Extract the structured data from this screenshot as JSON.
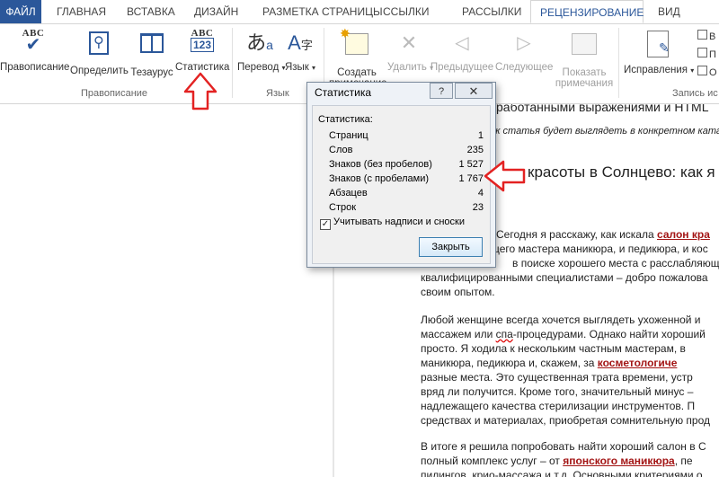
{
  "tabs": {
    "file": "ФАЙЛ",
    "items": [
      "ГЛАВНАЯ",
      "ВСТАВКА",
      "ДИЗАЙН",
      "РАЗМЕТКА СТРАНИЦЫ",
      "ССЫЛКИ",
      "РАССЫЛКИ",
      "РЕЦЕНЗИРОВАНИЕ",
      "ВИД"
    ],
    "active": "РЕЦЕНЗИРОВАНИЕ"
  },
  "ribbon": {
    "proofing": {
      "spelling": "Правописание",
      "define": "Определить",
      "thesaurus": "Тезаурус",
      "statistics": "Статистика",
      "group": "Правописание",
      "abc": "ABC",
      "num": "123"
    },
    "language": {
      "translate": "Перевод",
      "language": "Язык",
      "group": "Язык"
    },
    "comments": {
      "create1": "Создать",
      "create2": "примечание",
      "delete": "Удалить",
      "previous": "Предыдущее",
      "next": "Следующее",
      "show1": "Показать",
      "show2": "примечания",
      "group_fragment": "я"
    },
    "tracking": {
      "corrections": "Исправления",
      "group": "Запись ис",
      "small_b": "В",
      "small_p": "П",
      "small_o": "О"
    }
  },
  "dialog": {
    "title": "Статистика",
    "help": "?",
    "close_x": "✕",
    "header": "Статистика:",
    "rows": [
      {
        "label": "Страниц",
        "value": "1"
      },
      {
        "label": "Слов",
        "value": "235"
      },
      {
        "label": "Знаков (без пробелов)",
        "value": "1 527"
      },
      {
        "label": "Знаков (с пробелами)",
        "value": "1 767"
      },
      {
        "label": "Абзацев",
        "value": "4"
      },
      {
        "label": "Строк",
        "value": "23"
      }
    ],
    "checkbox_label": "Учитывать надписи и сноски",
    "checkbox_mark": "✓",
    "close_button": "Закрыть"
  },
  "document": {
    "heading1": "работанными выражениями и HTML",
    "subtitle": "как статья будет выглядеть в конкретном катало",
    "heading2": "красоты в Солнцево: как я и",
    "p1": {
      "l1a": "Сегодня я расскажу, как искала ",
      "l1b": "салон кра",
      "l2": "щего мастера маникюра, и педикюра, и кос",
      "l3": "в поиске хорошего места с расслабляюще",
      "l4": "квалифицированными специалистами – добро пожалова",
      "l5": "своим опытом."
    },
    "p2": {
      "l1": "Любой женщине всегда хочется выглядеть ухоженной и",
      "l2a": "массажем или ",
      "l2b": "спа",
      "l2c": "-процедурами. Однако найти хороший",
      "l3": "просто. Я ходила к нескольким частным мастерам, в",
      "l4a": "маникюра, педикюра и, скажем, за ",
      "l4b": "косметологиче",
      "l5": "разные места.  Это существенная трата времени, устр",
      "l6": "вряд ли получится. Кроме того, значительный минус –",
      "l7": "надлежащего качества стерилизации инструментов. П",
      "l8": "средствах и материалах, приобретая сомнительную прод"
    },
    "p3": {
      "l1": "В итоге я решила попробовать найти хороший салон в С",
      "l2a": "полный комплекс услуг – от ",
      "l2b": "японского маникюра",
      "l2c": ", пе",
      "l3a": "пилингов",
      "l3b": ", крио-массажа и т.д. Основными критериями о"
    }
  }
}
